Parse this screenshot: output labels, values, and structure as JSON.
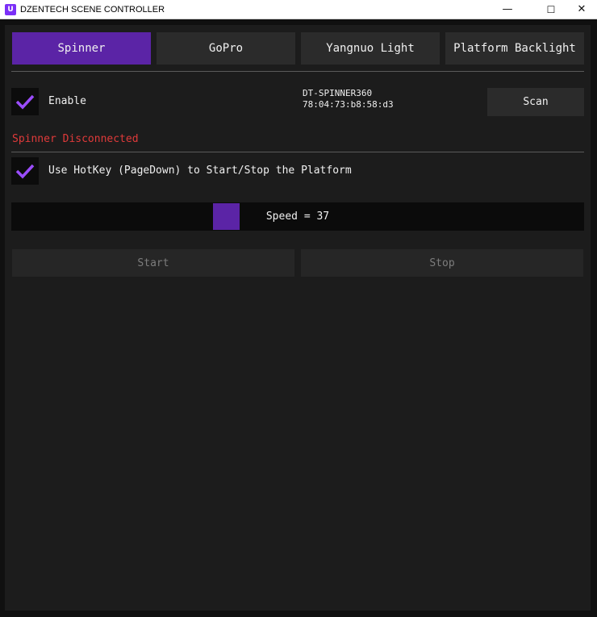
{
  "window": {
    "title": "DZENTECH SCENE CONTROLLER",
    "minimize": "—",
    "maximize": "☐",
    "close": "✕"
  },
  "tabs": [
    {
      "label": "Spinner",
      "active": true
    },
    {
      "label": "GoPro",
      "active": false
    },
    {
      "label": "Yangnuo Light",
      "active": false
    },
    {
      "label": "Platform Backlight",
      "active": false
    }
  ],
  "enable": {
    "label": "Enable",
    "checked": true
  },
  "device": {
    "name": "DT-SPINNER360",
    "mac": "78:04:73:b8:58:d3"
  },
  "scan_label": "Scan",
  "status": {
    "text": "Spinner Disconnected",
    "color": "#e03a3a"
  },
  "hotkey": {
    "label": "Use HotKey (PageDown) to Start/Stop the Platform",
    "checked": true
  },
  "speed": {
    "label": "Speed = 37",
    "value": 37,
    "max": 100
  },
  "buttons": {
    "start": "Start",
    "stop": "Stop"
  },
  "colors": {
    "accent": "#5b24a6",
    "check": "#9b4dff",
    "error": "#e03a3a"
  }
}
